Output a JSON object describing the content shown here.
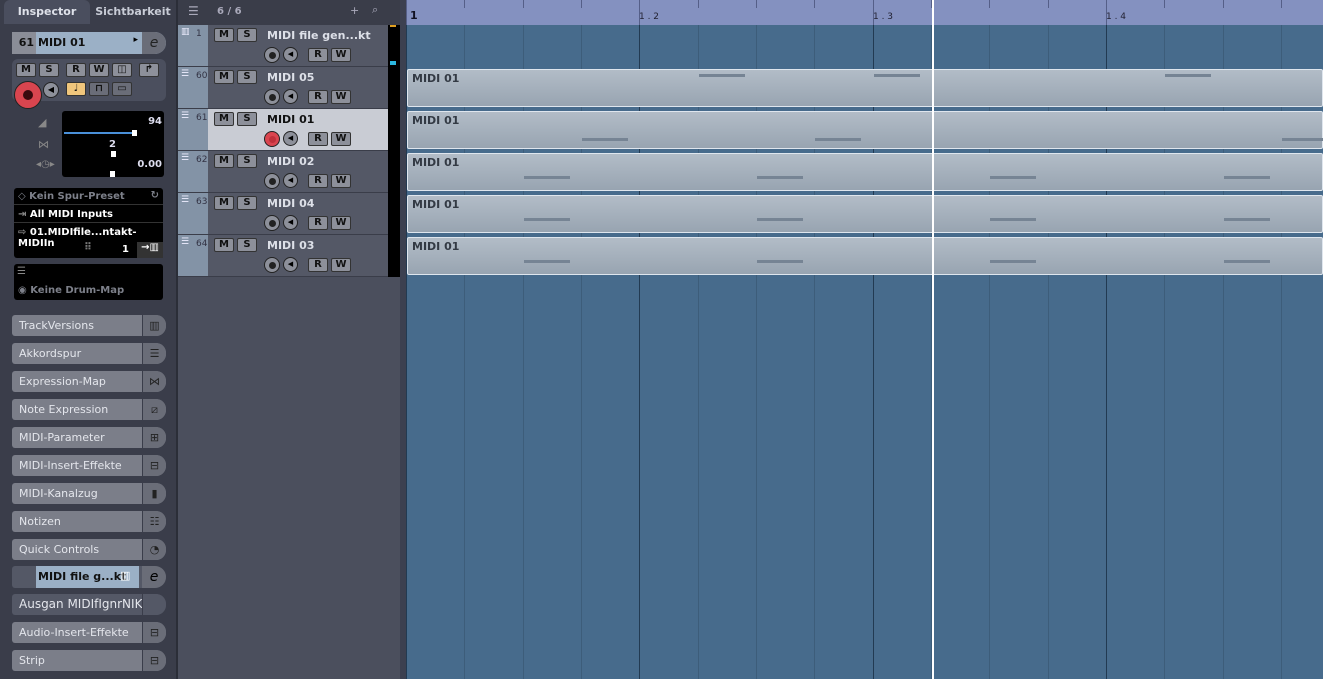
{
  "inspector": {
    "tabs": [
      "Inspector",
      "Sichtbarkeit"
    ],
    "track_number": "61",
    "track_name": "MIDI 01",
    "buttons": [
      "M",
      "S",
      "R",
      "W"
    ],
    "volume": "94",
    "transpose": "2",
    "delay": "0.00",
    "volume_fraction": 0.94,
    "preset": "Kein Spur-Preset",
    "input": "All MIDI Inputs",
    "output": "01.MIDIfile...ntakt-MIDIIn",
    "channel": "1",
    "drum_map": "Keine Drum-Map",
    "sections": [
      {
        "label": "TrackVersions",
        "icon": "▥"
      },
      {
        "label": "Akkordspur",
        "icon": "☰"
      },
      {
        "label": "Expression-Map",
        "icon": "⋈"
      },
      {
        "label": "Note Expression",
        "icon": "⧄"
      },
      {
        "label": "MIDI-Parameter",
        "icon": "⊞"
      },
      {
        "label": "MIDI-Insert-Effekte",
        "icon": "⊟"
      },
      {
        "label": "MIDI-Kanalzug",
        "icon": "▮"
      },
      {
        "label": "Notizen",
        "icon": "☷"
      },
      {
        "label": "Quick Controls",
        "icon": "◔"
      }
    ],
    "instrument_track": "MIDI file g...kt",
    "output_section": "Ausgan MIDIfIgnrNIK",
    "sections2": [
      {
        "label": "Audio-Insert-Effekte",
        "icon": "⊟"
      },
      {
        "label": "Strip",
        "icon": "⊟"
      }
    ]
  },
  "tracklist": {
    "count": "6 / 6",
    "tracks": [
      {
        "num": "1",
        "name": "MIDI file gen...kt"
      },
      {
        "num": "60",
        "name": "MIDI 05"
      },
      {
        "num": "61",
        "name": "MIDI 01",
        "selected": true
      },
      {
        "num": "62",
        "name": "MIDI 02"
      },
      {
        "num": "63",
        "name": "MIDI 04"
      },
      {
        "num": "64",
        "name": "MIDI 03"
      }
    ]
  },
  "ruler": {
    "labels": [
      "1",
      "1 . 2",
      "1 . 3",
      "1 . 4"
    ]
  },
  "parts": [
    {
      "label": "MIDI 01",
      "notes": [
        5,
        8,
        13
      ]
    },
    {
      "label": "MIDI 01",
      "notes": [
        3,
        7,
        15
      ]
    },
    {
      "label": "MIDI 01",
      "notes": [
        2,
        6,
        10,
        14
      ]
    },
    {
      "label": "MIDI 01",
      "notes": [
        2,
        6,
        10,
        14
      ]
    },
    {
      "label": "MIDI 01",
      "notes": [
        2,
        6,
        10,
        14
      ]
    }
  ],
  "colors": {
    "arrange_bg": "#476b8c",
    "ruler": "#8491c0",
    "record": "#d9454f"
  }
}
